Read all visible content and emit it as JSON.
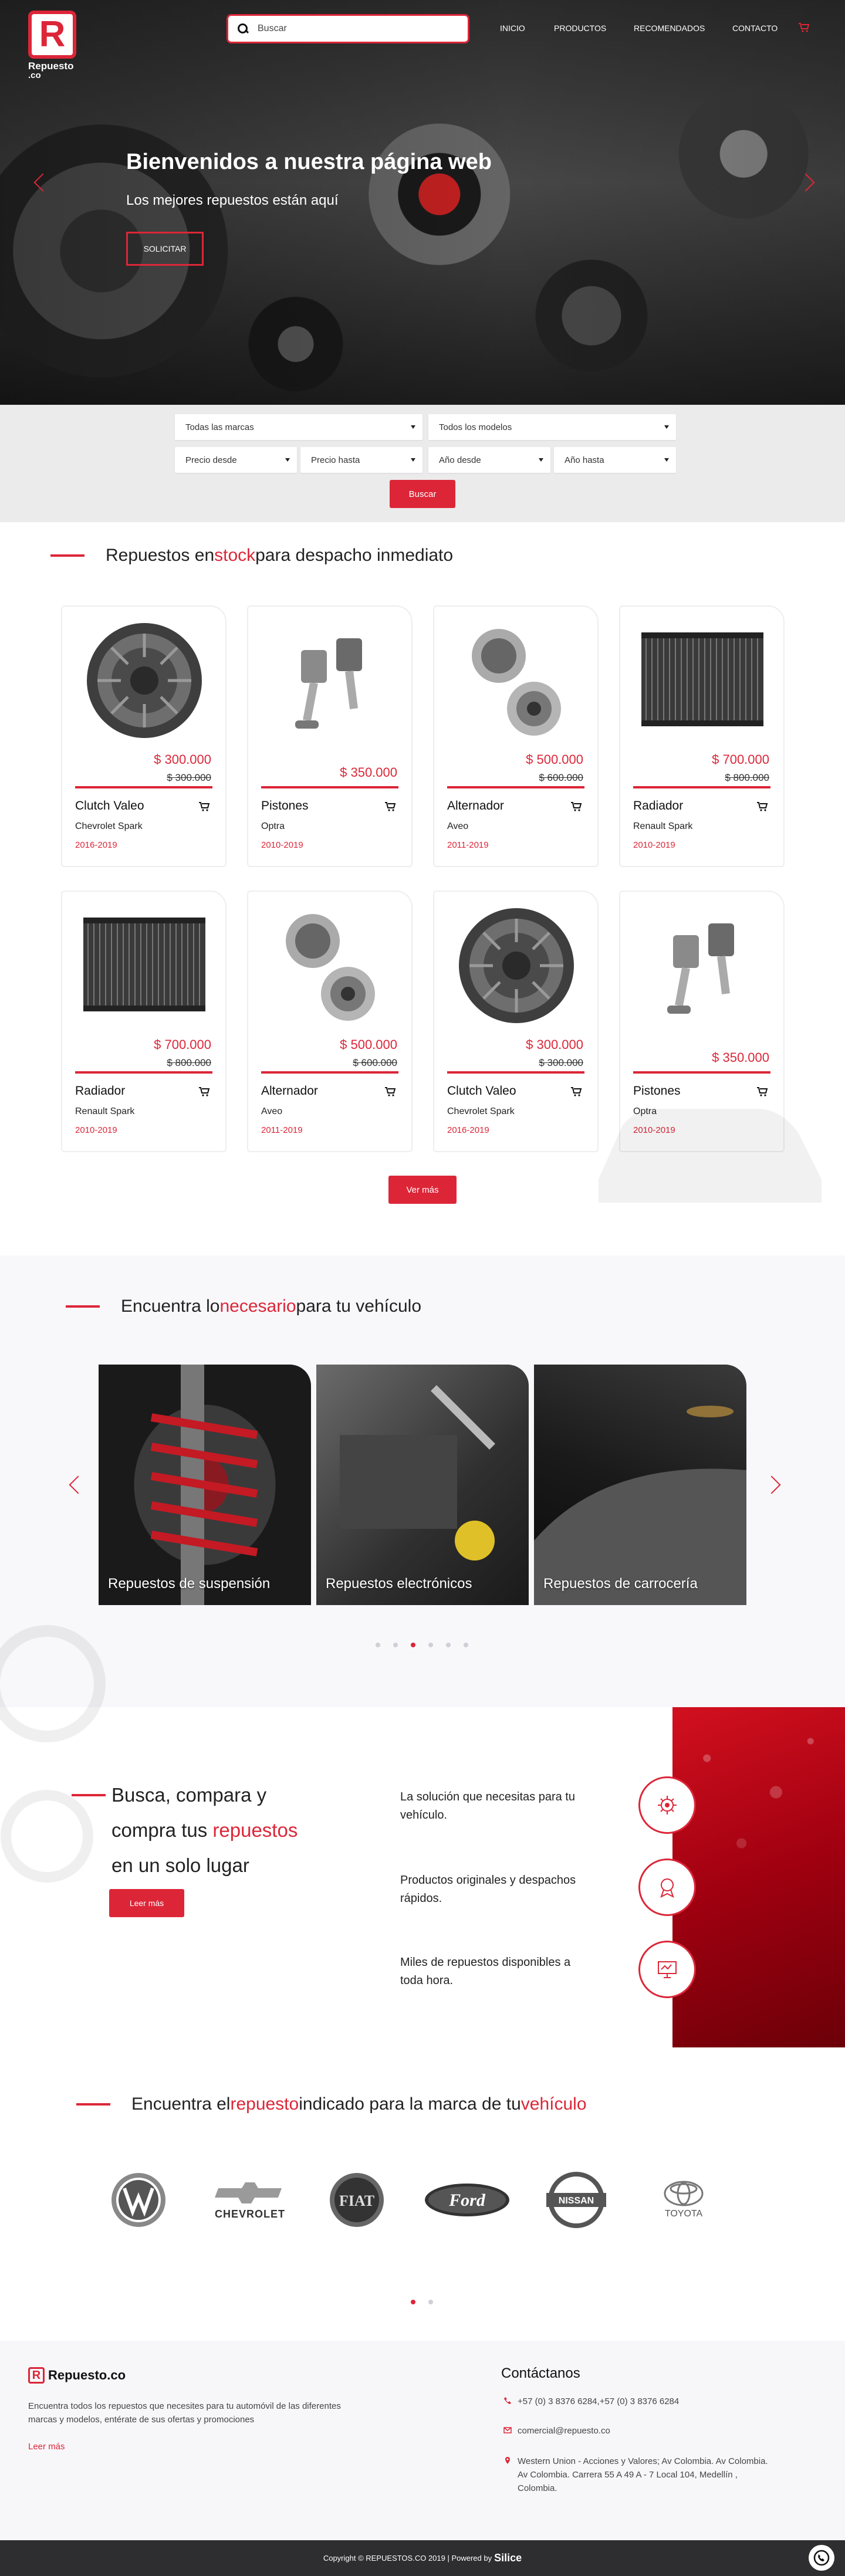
{
  "header": {
    "logo_name": "Repuesto",
    "logo_tld": ".co",
    "search_placeholder": "Buscar",
    "nav": [
      "INICIO",
      "PRODUCTOS",
      "RECOMENDADOS",
      "CONTACTO"
    ],
    "accent": "#dc2638"
  },
  "hero": {
    "title": "Bienvenidos a nuestra página web",
    "subtitle": "Los mejores repuestos están aquí",
    "button": "SOLICITAR"
  },
  "filter": {
    "brand": "Todas las marcas",
    "model": "Todos los modelos",
    "price_from": "Precio desde",
    "price_to": "Precio hasta",
    "year_from": "Año desde",
    "year_to": "Año hasta",
    "button": "Buscar"
  },
  "stock": {
    "title_a": "Repuestos en ",
    "title_b": "stock",
    "title_c": " para despacho inmediato",
    "more_button": "Ver más",
    "products": [
      {
        "name": "Clutch Valeo",
        "price": "$ 300.000",
        "old": "$ 300.000",
        "model": "Chevrolet Spark",
        "years": "2016-2019",
        "icon": "clutch"
      },
      {
        "name": "Pistones",
        "price": "$ 350.000",
        "old": "",
        "model": "Optra",
        "years": "2010-2019",
        "icon": "piston"
      },
      {
        "name": "Alternador",
        "price": "$ 500.000",
        "old": "$ 600.000",
        "model": "Aveo",
        "years": "2011-2019",
        "icon": "alternator"
      },
      {
        "name": "Radiador",
        "price": "$ 700.000",
        "old": "$ 800.000",
        "model": "Renault Spark",
        "years": "2010-2019",
        "icon": "radiator"
      },
      {
        "name": "Radiador",
        "price": "$ 700.000",
        "old": "$ 800.000",
        "model": "Renault Spark",
        "years": "2010-2019",
        "icon": "radiator"
      },
      {
        "name": "Alternador",
        "price": "$ 500.000",
        "old": "$ 600.000",
        "model": "Aveo",
        "years": "2011-2019",
        "icon": "alternator"
      },
      {
        "name": "Clutch Valeo",
        "price": "$ 300.000",
        "old": "$ 300.000",
        "model": "Chevrolet Spark",
        "years": "2016-2019",
        "icon": "clutch"
      },
      {
        "name": "Pistones",
        "price": "$ 350.000",
        "old": "",
        "model": "Optra",
        "years": "2010-2019",
        "icon": "piston"
      }
    ]
  },
  "categories": {
    "title_a": "Encuentra lo ",
    "title_b": "necesario",
    "title_c": " para tu vehículo",
    "items": [
      "Repuestos de suspensión",
      "Repuestos electrónicos",
      "Repuestos de carrocería"
    ],
    "active_dot": 2
  },
  "info": {
    "line1": "Busca, compara y",
    "line2a": "compra tus ",
    "line2b": "repuestos",
    "line3": "en un solo lugar",
    "button": "Leer más",
    "features": [
      {
        "text": "La solución que necesitas para tu vehículo.",
        "icon": "gear-icon"
      },
      {
        "text": "Productos originales y despachos rápidos.",
        "icon": "badge-icon"
      },
      {
        "text": "Miles de repuestos disponibles a toda hora.",
        "icon": "monitor-icon"
      }
    ]
  },
  "brands": {
    "title_a": "Encuentra el ",
    "title_b": "repuesto",
    "title_c": " indicado para la marca de tu ",
    "title_d": "vehículo",
    "items": [
      "VW",
      "CHEVROLET",
      "FIAT",
      "Ford",
      "NISSAN",
      "TOYOTA"
    ],
    "active_dot": 0
  },
  "footer": {
    "logo": "Repuesto.co",
    "desc": "Encuentra todos los repuestos que necesites para tu automóvil de las diferentes marcas y modelos, entérate de sus ofertas y promociones",
    "more": "Leer más",
    "contact_title": "Contáctanos",
    "phone": "+57 (0) 3 8376 6284,+57 (0) 3 8376 6284",
    "email": "comercial@repuesto.co",
    "address": "Western Union - Acciones y Valores; Av Colombia. Av Colombia. Av Colombia. Carrera 55 A 49 A - 7 Local 104, Medellín , Colombia.",
    "copyright": "Copyright © REPUESTOS.CO 2019 | Powered by ",
    "powered": "Silice"
  }
}
